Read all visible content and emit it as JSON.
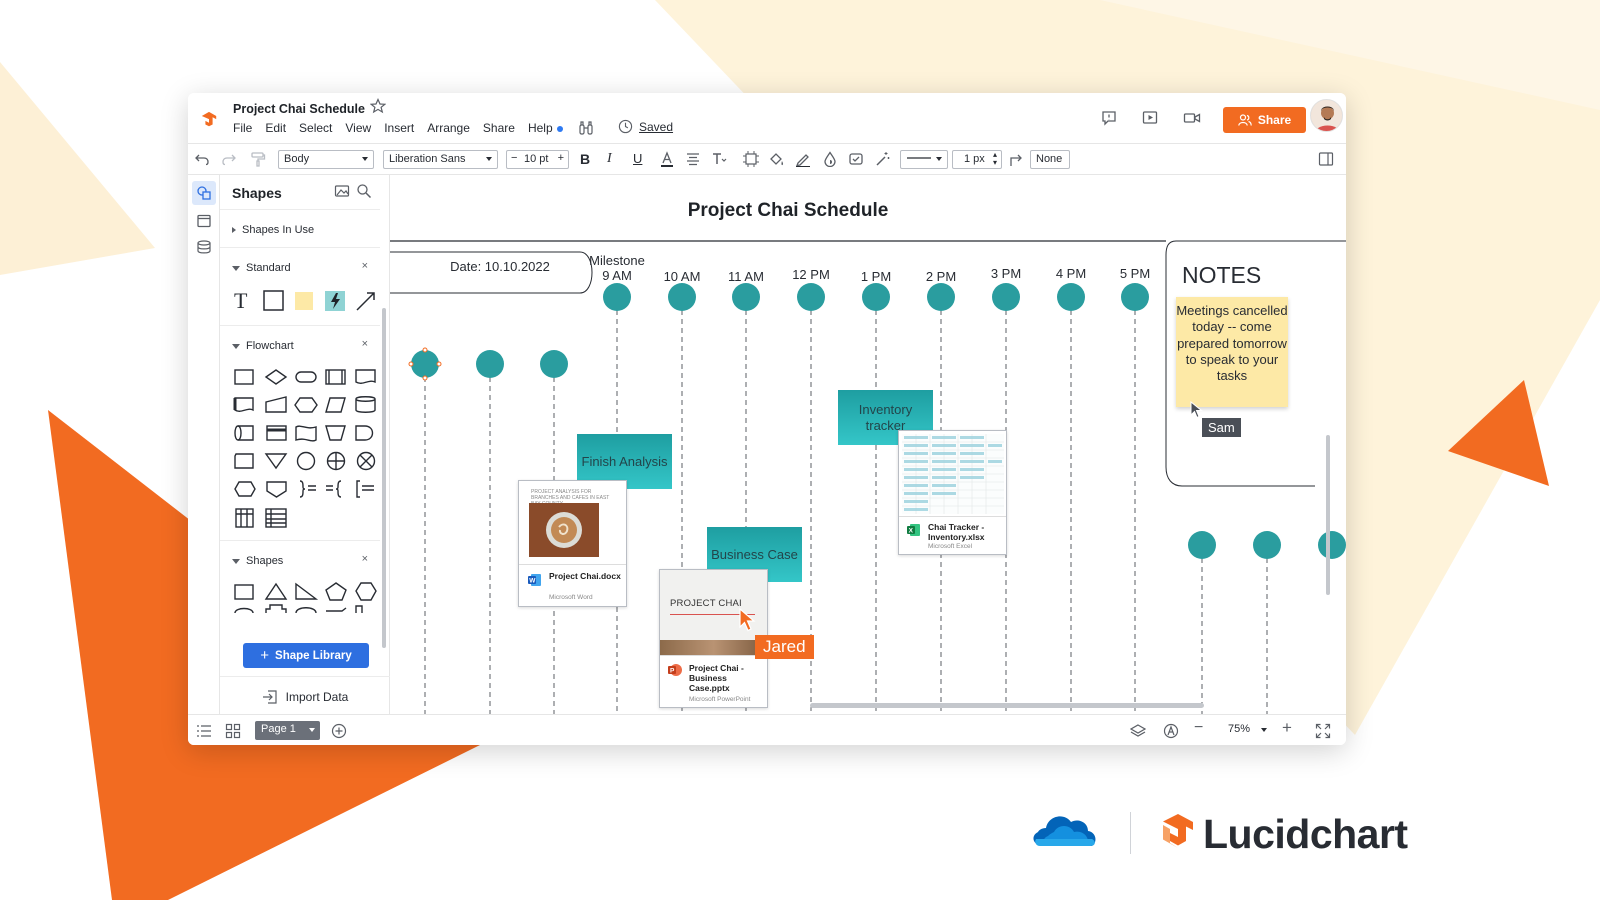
{
  "app": {
    "doc_title": "Project Chai Schedule",
    "menu": [
      "File",
      "Edit",
      "Select",
      "View",
      "Insert",
      "Arrange",
      "Share",
      "Help"
    ],
    "saved_label": "Saved",
    "share_label": "Share"
  },
  "toolbar": {
    "style_select": "Body",
    "font_select": "Liberation Sans",
    "font_size": "10 pt",
    "line_width": "1 px",
    "arrow_style": "None"
  },
  "panel": {
    "title": "Shapes",
    "sections": {
      "in_use": "Shapes In Use",
      "standard": "Standard",
      "flowchart": "Flowchart",
      "shapes": "Shapes"
    },
    "shape_library_label": "Shape Library",
    "import_data_label": "Import Data"
  },
  "bottom": {
    "page_tab": "Page 1",
    "zoom": "75%"
  },
  "canvas": {
    "title": "Project Chai Schedule",
    "date_label": "Date: 10.10.2022",
    "milestone_label": "Milestone",
    "times": [
      "9 AM",
      "10 AM",
      "11 AM",
      "12 PM",
      "1 PM",
      "2 PM",
      "3 PM",
      "4 PM",
      "5 PM"
    ],
    "notes_title": "NOTES",
    "note_text": "Meetings cancelled today -- come prepared tomorrow to speak to your tasks",
    "tasks": {
      "finish_analysis": "Finish Analysis",
      "business_case": "Business Case",
      "inventory_tracker": "Inventory tracker"
    },
    "docs": {
      "word": {
        "name": "Project Chai.docx",
        "app": "Microsoft Word",
        "preview_text": "PROJECT ANALYSIS FOR BRANCHES AND CAFES IN EAST BAY COUNTY"
      },
      "ppt": {
        "name": "Project Chai - Business Case.pptx",
        "app": "Microsoft PowerPoint",
        "preview_title": "PROJECT CHAI"
      },
      "excel": {
        "name": "Chai Tracker - Inventory.xlsx",
        "app": "Microsoft Excel"
      }
    },
    "cursors": {
      "sam": {
        "name": "Sam",
        "color": "#4a4f57"
      },
      "jared": {
        "name": "Jared",
        "color": "#f26b21"
      }
    }
  },
  "branding": {
    "product": "Lucidchart"
  },
  "colors": {
    "accent_orange": "#f26b21",
    "teal_dot": "#2a9d9f",
    "primary_blue": "#2e6fe0",
    "note_yellow": "#fde9a6"
  }
}
